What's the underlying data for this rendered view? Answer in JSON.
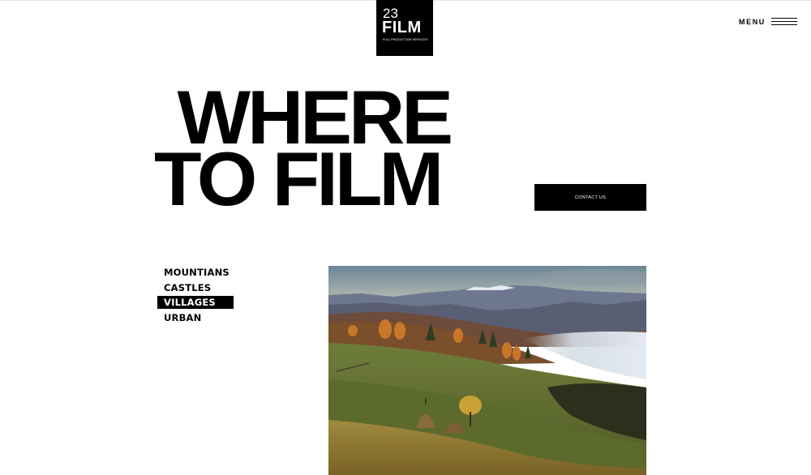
{
  "logo": {
    "number": "23",
    "word": "FILM",
    "tagline": "FULL PRODUCTION SERVICES"
  },
  "nav": {
    "menu_label": "MENU",
    "menu_icon": "hamburger-icon"
  },
  "hero": {
    "line1": "WHERE",
    "line2": "TO FILM"
  },
  "contact": {
    "label": "CONTACT US"
  },
  "categories": {
    "items": [
      {
        "label": "MOUNTIANS",
        "active": false
      },
      {
        "label": "CASTLES",
        "active": false
      },
      {
        "label": "VILLAGES",
        "active": true
      },
      {
        "label": "URBAN",
        "active": false
      }
    ]
  },
  "colors": {
    "background": "#ffffff",
    "ink": "#000000",
    "sky_top": "#6f8a9a",
    "sky_horizon": "#d9c6a0",
    "meadow": "#7d8a3a",
    "autumn_trees": "#c8772a"
  }
}
